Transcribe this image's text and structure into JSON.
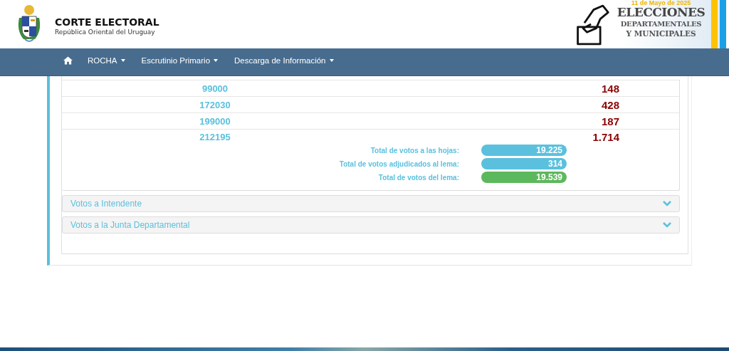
{
  "header": {
    "title": "CORTE ELECTORAL",
    "subtitle": "República Oriental del Uruguay",
    "banner": {
      "date": "11 de Mayo de 2025",
      "line_1": "ELECCIONES",
      "line_2": "DEPARTAMENTALES",
      "line_3": "Y MUNICIPALES"
    }
  },
  "navbar": {
    "items": [
      {
        "label": "ROCHA",
        "dropdown": true
      },
      {
        "label": "Escrutinio Primario",
        "dropdown": true
      },
      {
        "label": "Descarga de Información",
        "dropdown": true
      }
    ]
  },
  "table": {
    "rows": [
      {
        "column_1": "99000",
        "column_2": "148"
      },
      {
        "column_1": "172030",
        "column_2": "428"
      },
      {
        "column_1": "199000",
        "column_2": "187"
      },
      {
        "column_1": "212195",
        "column_2": "1.714"
      }
    ]
  },
  "totals": [
    {
      "label": "Total de votos a las hojas:",
      "value": "19.225",
      "color": "#5bc0de"
    },
    {
      "label": "Total de votos adjudicados al lema:",
      "value": "314",
      "color": "#5bc0de"
    },
    {
      "label": "Total de votos del lema:",
      "value": "19.539",
      "color": "#5cb85c"
    }
  ],
  "sections": [
    {
      "title": "Votos a Intendente",
      "expanded": false
    },
    {
      "title": "Votos a la Junta Departamental",
      "expanded": false
    }
  ]
}
